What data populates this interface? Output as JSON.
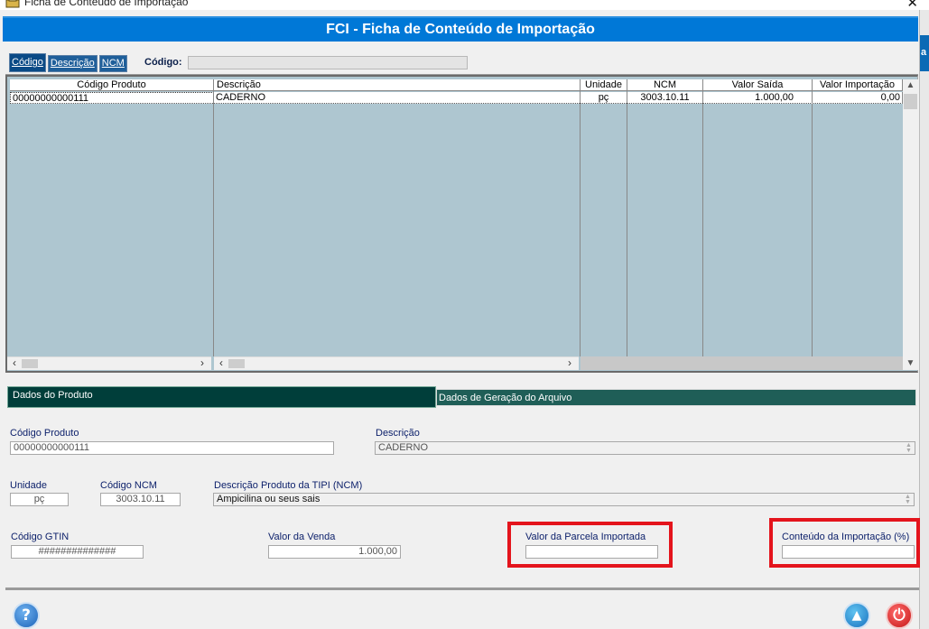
{
  "window": {
    "title": "Ficha de Conteúdo de Importação",
    "close_glyph": "✕"
  },
  "behind": {
    "fragment": "a"
  },
  "header": {
    "title": "FCI - Ficha de Conteúdo de Importação"
  },
  "search": {
    "tabs": [
      "Código",
      "Descrição",
      "NCM"
    ],
    "active_tab": "Código",
    "label": "Código:",
    "value": ""
  },
  "grid": {
    "columns": [
      "Código Produto",
      "Descrição",
      "Unidade",
      "NCM",
      "Valor Saída",
      "Valor Importação"
    ],
    "rows": [
      [
        "00000000000111",
        "CADERNO",
        "pç",
        "3003.10.11",
        "1.000,00",
        "0,00"
      ]
    ]
  },
  "sections": {
    "tab1": "Dados do Produto",
    "tab2": "Dados de Geração do Arquivo"
  },
  "form": {
    "codigo_produto": {
      "label": "Código Produto",
      "value": "00000000000111"
    },
    "descricao": {
      "label": "Descrição",
      "value": "CADERNO"
    },
    "unidade": {
      "label": "Unidade",
      "value": "pç"
    },
    "codigo_ncm": {
      "label": "Código NCM",
      "value": "3003.10.11"
    },
    "descricao_tipi": {
      "label": "Descrição Produto da TIPI (NCM)",
      "value": "Ampicilina ou seus sais"
    },
    "codigo_gtin": {
      "label": "Código GTIN",
      "value": "##############"
    },
    "valor_venda": {
      "label": "Valor da Venda",
      "value": "1.000,00"
    },
    "valor_parcela": {
      "label": "Valor da Parcela Importada",
      "value": ""
    },
    "conteudo_importacao": {
      "label": "Conteúdo da Importação (%)",
      "value": ""
    }
  },
  "buttons": {
    "help": "?",
    "up": "▲",
    "power": "⏻"
  },
  "icons": {
    "app": "app-icon",
    "help": "help-icon",
    "up": "up-arrow-icon",
    "power": "power-icon"
  },
  "colors": {
    "header": "#0078d7",
    "section_active": "#003e3a",
    "highlight": "#e4141c"
  }
}
